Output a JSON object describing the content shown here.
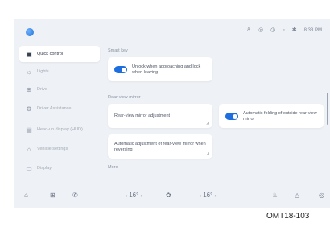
{
  "status_bar": {
    "icons": [
      "seat-icon",
      "camera-icon",
      "clock-icon",
      "signal-icon",
      "bluetooth-icon"
    ],
    "time": "8:33 PM"
  },
  "sidebar": {
    "items": [
      {
        "icon": "car-icon",
        "label": "Quick control"
      },
      {
        "icon": "light-icon",
        "label": "Lights"
      },
      {
        "icon": "steering-icon",
        "label": "Drive"
      },
      {
        "icon": "assist-icon",
        "label": "Driver Assistance"
      },
      {
        "icon": "hud-icon",
        "label": "Head-up display (HUD)"
      },
      {
        "icon": "vehicle-icon",
        "label": "Vehicle settings"
      },
      {
        "icon": "display-icon",
        "label": "Display"
      }
    ]
  },
  "sections": {
    "smart_key": "Smart key",
    "rear_view": "Rear-view mirror",
    "more": "More"
  },
  "cards": {
    "unlock": "Unlock when approaching and lock when leaving",
    "mirror_adjust": "Rear-view mirror adjustment",
    "auto_fold": "Automatic folding of outside rear-view mirror",
    "auto_adjust": "Automatic adjustment of rear-view mirror when reversing"
  },
  "bottom_bar": {
    "left_temp": "16",
    "right_temp": "16",
    "degree": "°"
  },
  "caption": "OMT18-103"
}
